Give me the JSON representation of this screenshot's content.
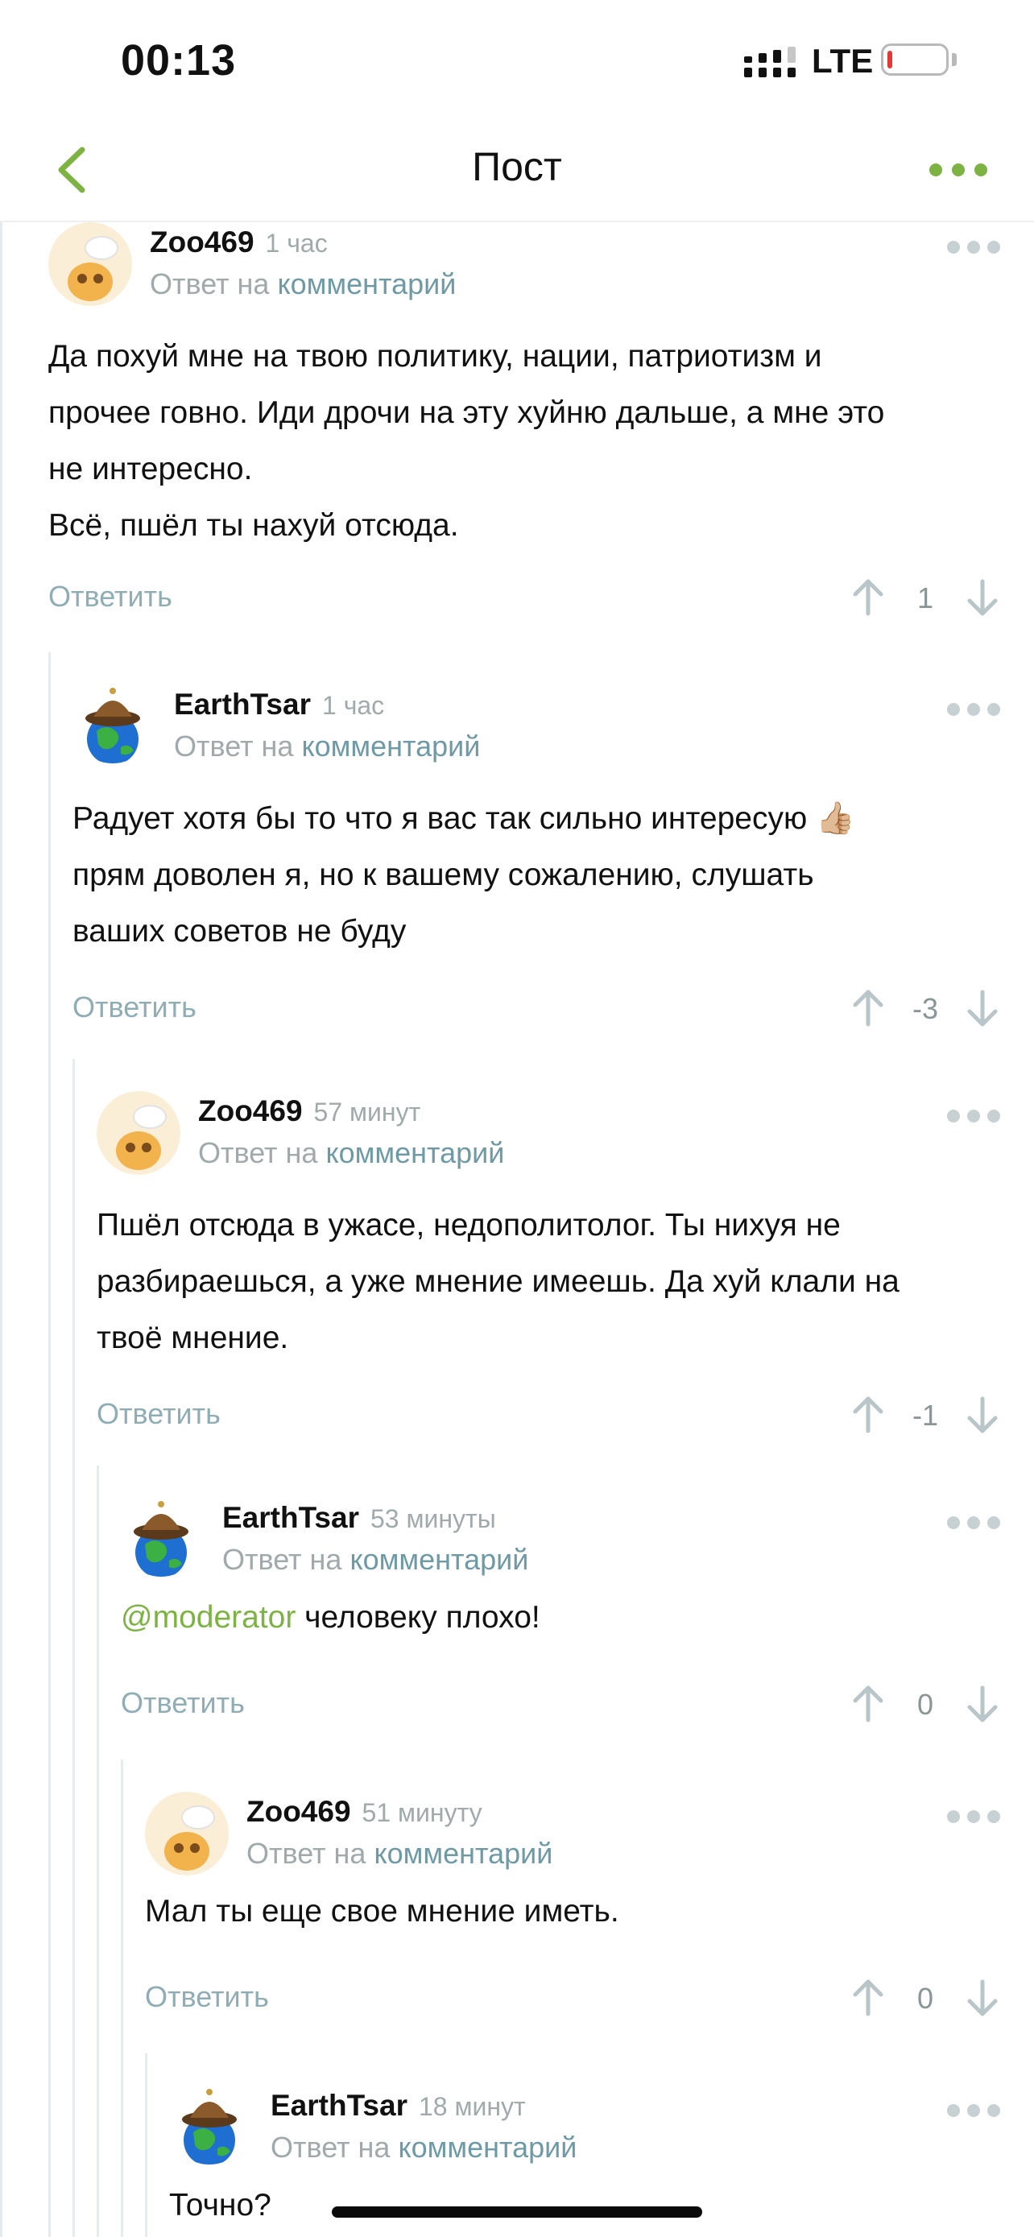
{
  "status": {
    "time": "00:13",
    "network": "LTE"
  },
  "nav": {
    "title": "Пост"
  },
  "comments": [
    {
      "author": "Zoo469",
      "time": "1 час",
      "reply_prefix": "Ответ на",
      "reply_link": "комментарий",
      "body_lines": [
        "Да похуй мне на твою политику, нации, патриотизм и",
        "прочее говно. Иди дрочи на эту хуйню дальше, а мне это",
        "не интересно.",
        "Всё, пшёл ты нахуй отсюда."
      ],
      "reply_label": "Ответить",
      "score": "1"
    },
    {
      "author": "EarthTsar",
      "time": "1 час",
      "reply_prefix": "Ответ на",
      "reply_link": "комментарий",
      "body_lines": [
        "Радует хотя бы то что я вас так сильно интересую 👍🏼",
        "прям доволен я, но к вашему сожалению, слушать",
        "ваших советов не буду"
      ],
      "reply_label": "Ответить",
      "score": "-3"
    },
    {
      "author": "Zoo469",
      "time": "57 минут",
      "reply_prefix": "Ответ на",
      "reply_link": "комментарий",
      "body_lines": [
        "Пшёл отсюда в ужасе, недополитолог. Ты нихуя не",
        "разбираешься, а уже мнение имеешь. Да хуй клали на",
        "твоё мнение."
      ],
      "reply_label": "Ответить",
      "score": "-1"
    },
    {
      "author": "EarthTsar",
      "time": "53 минуты",
      "reply_prefix": "Ответ на",
      "reply_link": "комментарий",
      "mention": "@moderator",
      "body_text": " человеку плохо!",
      "reply_label": "Ответить",
      "score": "0"
    },
    {
      "author": "Zoo469",
      "time": "51 минуту",
      "reply_prefix": "Ответ на",
      "reply_link": "комментарий",
      "body_lines": [
        "Мал ты еще свое мнение иметь."
      ],
      "reply_label": "Ответить",
      "score": "0"
    },
    {
      "author": "EarthTsar",
      "time": "18 минут",
      "reply_prefix": "Ответ на",
      "reply_link": "комментарий",
      "body_lines": [
        "Точно?"
      ]
    }
  ],
  "colors": {
    "accent": "#7cb342",
    "link": "#6e9aa6",
    "muted": "#a0a9ab"
  }
}
